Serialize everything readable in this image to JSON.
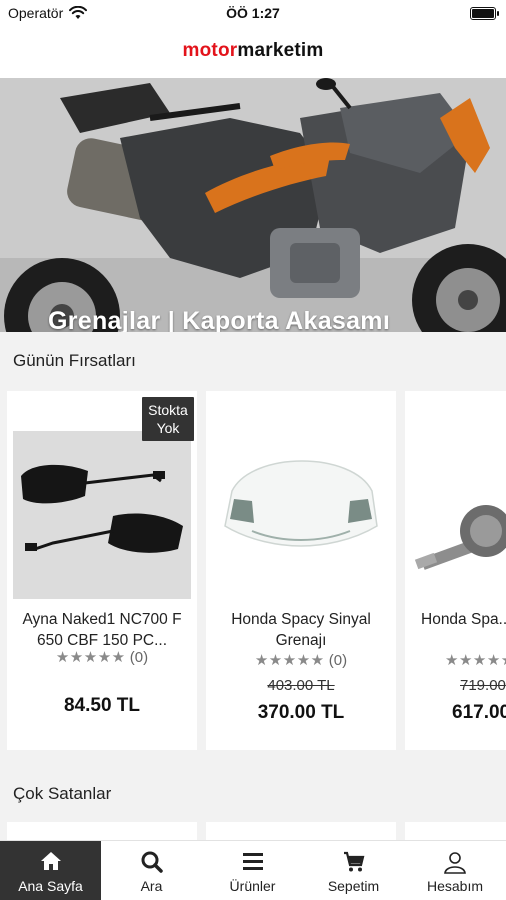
{
  "status_bar": {
    "carrier": "Operatör",
    "time": "ÖÖ 1:27"
  },
  "header": {
    "logo_part1": "motor",
    "logo_part2": "marketim"
  },
  "banner": {
    "title": "Grenajlar | Kaporta Akasamı"
  },
  "deals": {
    "title": "Günün Fırsatları",
    "items": [
      {
        "badge": "Stokta Yok",
        "name": "Ayna Naked1 NC700 F 650 CBF 150 PC...",
        "stars": "★★★★★",
        "reviews": "(0)",
        "old_price": "",
        "price": "84.50 TL"
      },
      {
        "badge": "",
        "name": "Honda Spacy Sinyal Grenajı",
        "stars": "★★★★★",
        "reviews": "(0)",
        "old_price": "403.00 TL",
        "price": "370.00 TL"
      },
      {
        "badge": "",
        "name": "Honda Spa... - Bily...",
        "stars": "★★★★★",
        "reviews": "",
        "old_price": "719.00",
        "price": "617.00"
      }
    ]
  },
  "best_sellers": {
    "title": "Çok Satanlar"
  },
  "tabbar": {
    "items": [
      {
        "label": "Ana Sayfa",
        "icon": "home-icon",
        "active": true
      },
      {
        "label": "Ara",
        "icon": "search-icon",
        "active": false
      },
      {
        "label": "Ürünler",
        "icon": "menu-icon",
        "active": false
      },
      {
        "label": "Sepetim",
        "icon": "cart-icon",
        "active": false
      },
      {
        "label": "Hesabım",
        "icon": "user-icon",
        "active": false
      }
    ]
  }
}
